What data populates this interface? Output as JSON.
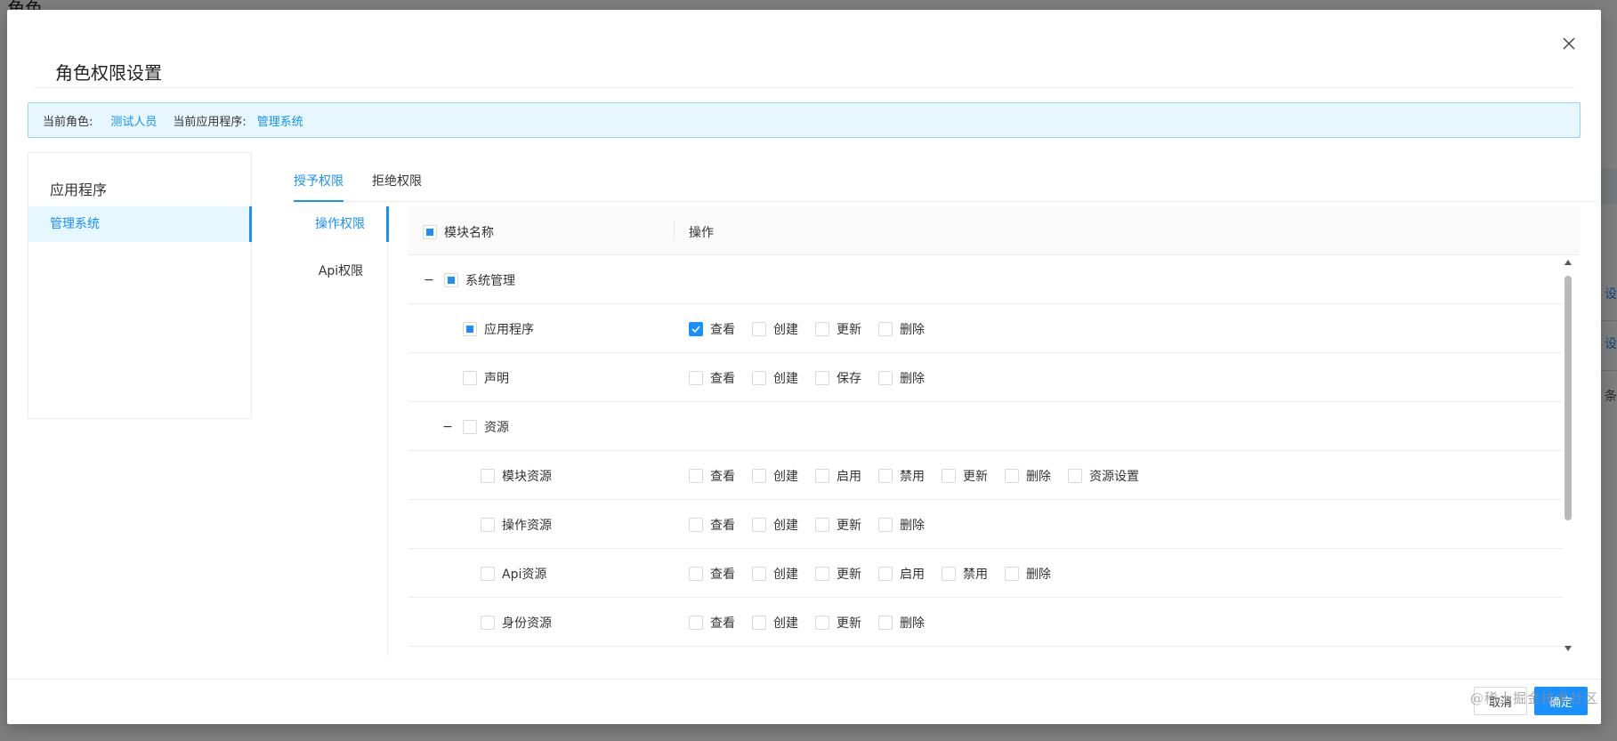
{
  "background": {
    "title": "角色",
    "links": [
      "设置",
      "设置",
      "条/页"
    ]
  },
  "modal": {
    "title": "角色权限设置",
    "alert": {
      "role_label": "当前角色:",
      "role_value": "测试人员",
      "app_label": "当前应用程序:",
      "app_value": "管理系统"
    },
    "app_panel": {
      "title": "应用程序",
      "items": [
        {
          "label": "管理系统",
          "selected": true
        }
      ]
    },
    "tabs": [
      {
        "label": "授予权限",
        "active": true
      },
      {
        "label": "拒绝权限",
        "active": false
      }
    ],
    "vtabs": [
      {
        "label": "操作权限",
        "active": true
      },
      {
        "label": "Api权限",
        "active": false
      }
    ],
    "table": {
      "headers": [
        "模块名称",
        "操作"
      ],
      "rows": [
        {
          "name": "系统管理",
          "level": 0,
          "expander": "−",
          "state": "indeterminate",
          "ops": []
        },
        {
          "name": "应用程序",
          "level": 1,
          "expander": "",
          "state": "indeterminate",
          "ops": [
            {
              "label": "查看",
              "checked": true
            },
            {
              "label": "创建",
              "checked": false
            },
            {
              "label": "更新",
              "checked": false
            },
            {
              "label": "删除",
              "checked": false
            }
          ]
        },
        {
          "name": "声明",
          "level": 1,
          "expander": "",
          "state": "unchecked",
          "ops": [
            {
              "label": "查看",
              "checked": false
            },
            {
              "label": "创建",
              "checked": false
            },
            {
              "label": "保存",
              "checked": false
            },
            {
              "label": "删除",
              "checked": false
            }
          ]
        },
        {
          "name": "资源",
          "level": 1,
          "expander": "−",
          "state": "unchecked",
          "ops": []
        },
        {
          "name": "模块资源",
          "level": 2,
          "expander": "",
          "state": "unchecked",
          "ops": [
            {
              "label": "查看",
              "checked": false
            },
            {
              "label": "创建",
              "checked": false
            },
            {
              "label": "启用",
              "checked": false
            },
            {
              "label": "禁用",
              "checked": false
            },
            {
              "label": "更新",
              "checked": false
            },
            {
              "label": "删除",
              "checked": false
            },
            {
              "label": "资源设置",
              "checked": false
            }
          ]
        },
        {
          "name": "操作资源",
          "level": 2,
          "expander": "",
          "state": "unchecked",
          "ops": [
            {
              "label": "查看",
              "checked": false
            },
            {
              "label": "创建",
              "checked": false
            },
            {
              "label": "更新",
              "checked": false
            },
            {
              "label": "删除",
              "checked": false
            }
          ]
        },
        {
          "name": "Api资源",
          "level": 2,
          "expander": "",
          "state": "unchecked",
          "ops": [
            {
              "label": "查看",
              "checked": false
            },
            {
              "label": "创建",
              "checked": false
            },
            {
              "label": "更新",
              "checked": false
            },
            {
              "label": "启用",
              "checked": false
            },
            {
              "label": "禁用",
              "checked": false
            },
            {
              "label": "删除",
              "checked": false
            }
          ]
        },
        {
          "name": "身份资源",
          "level": 2,
          "expander": "",
          "state": "unchecked",
          "ops": [
            {
              "label": "查看",
              "checked": false
            },
            {
              "label": "创建",
              "checked": false
            },
            {
              "label": "更新",
              "checked": false
            },
            {
              "label": "删除",
              "checked": false
            }
          ]
        }
      ]
    },
    "footer": {
      "cancel_label": "取消",
      "ok_label": "确定"
    }
  },
  "watermark": "@稀土掘金技术社区",
  "colors": {
    "accent": "#1890ff",
    "alert_bg": "#e6f7ff",
    "alert_border": "#91d5ff"
  }
}
